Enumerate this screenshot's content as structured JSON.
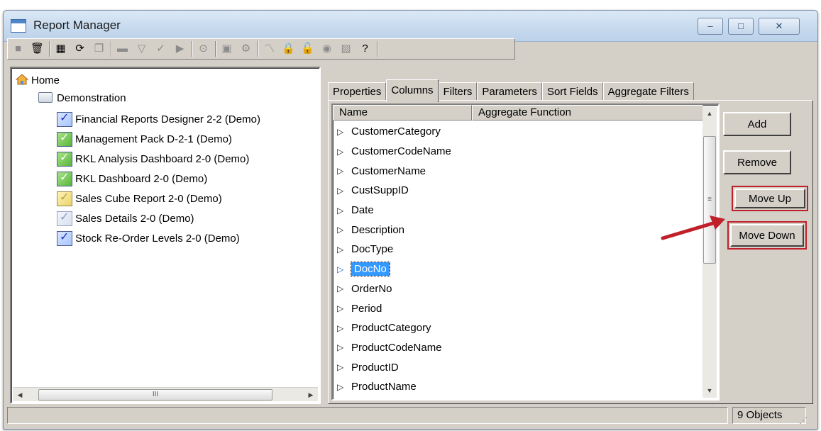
{
  "window": {
    "title": "Report Manager",
    "controls": {
      "minimize": "–",
      "maximize": "□",
      "close": "✕"
    }
  },
  "toolbar": {
    "buttons": [
      {
        "icon": "stop-icon",
        "glyph": "■",
        "enabled": false
      },
      {
        "icon": "delete-icon",
        "glyph": "🗑",
        "enabled": true
      },
      {
        "icon": "grid-icon",
        "glyph": "▦",
        "enabled": true
      },
      {
        "icon": "refresh-icon",
        "glyph": "⟳",
        "enabled": true
      },
      {
        "icon": "copy-icon",
        "glyph": "❐",
        "enabled": false
      },
      {
        "icon": "folder-icon",
        "glyph": "▬",
        "enabled": false
      },
      {
        "icon": "filter-icon",
        "glyph": "▽",
        "enabled": false
      },
      {
        "icon": "check-icon",
        "glyph": "✓",
        "enabled": false
      },
      {
        "icon": "run-icon",
        "glyph": "▶",
        "enabled": false
      },
      {
        "icon": "schedule-icon",
        "glyph": "⊙",
        "enabled": false
      },
      {
        "icon": "window-icon",
        "glyph": "▣",
        "enabled": false
      },
      {
        "icon": "settings-icon",
        "glyph": "⚙",
        "enabled": false
      },
      {
        "icon": "chart-icon",
        "glyph": "〽",
        "enabled": false
      },
      {
        "icon": "lock-icon",
        "glyph": "🔒",
        "enabled": false
      },
      {
        "icon": "unlock-icon",
        "glyph": "🔓",
        "enabled": false
      },
      {
        "icon": "globe-icon",
        "glyph": "◉",
        "enabled": false
      },
      {
        "icon": "image-icon",
        "glyph": "▨",
        "enabled": false
      },
      {
        "icon": "help-icon",
        "glyph": "?",
        "enabled": true
      }
    ]
  },
  "tree": {
    "root": "Home",
    "folder": "Demonstration",
    "items": [
      {
        "label": "Financial Reports Designer 2-2 (Demo)",
        "color": "blue"
      },
      {
        "label": "Management Pack D-2-1 (Demo)",
        "color": "green"
      },
      {
        "label": "RKL Analysis Dashboard 2-0 (Demo)",
        "color": "green"
      },
      {
        "label": "RKL Dashboard 2-0 (Demo)",
        "color": "green"
      },
      {
        "label": "Sales Cube Report 2-0 (Demo)",
        "color": "yellow"
      },
      {
        "label": "Sales Details 2-0 (Demo)",
        "color": "light"
      },
      {
        "label": "Stock Re-Order Levels 2-0 (Demo)",
        "color": "blue"
      }
    ],
    "scroll_thumb_glyph": "III"
  },
  "tabs": [
    {
      "label": "Properties",
      "active": false
    },
    {
      "label": "Columns",
      "active": true
    },
    {
      "label": "Filters",
      "active": false
    },
    {
      "label": "Parameters",
      "active": false
    },
    {
      "label": "Sort Fields",
      "active": false
    },
    {
      "label": "Aggregate Filters",
      "active": false
    }
  ],
  "columns_list": {
    "headers": {
      "name": "Name",
      "aggregate": "Aggregate Function"
    },
    "rows": [
      "CustomerCategory",
      "CustomerCodeName",
      "CustomerName",
      "CustSuppID",
      "Date",
      "Description",
      "DocType",
      "DocNo",
      "OrderNo",
      "Period",
      "ProductCategory",
      "ProductCodeName",
      "ProductID",
      "ProductName"
    ],
    "selected": "DocNo",
    "scroll_thumb_glyph": "≡"
  },
  "buttons": {
    "add": "Add",
    "remove": "Remove",
    "move_up": "Move Up",
    "move_down": "Move Down"
  },
  "status": {
    "left": "",
    "objects": "9 Objects"
  },
  "colors": {
    "highlight_outline": "#c0202a",
    "arrow": "#c0202a",
    "selection": "#3399ff"
  }
}
